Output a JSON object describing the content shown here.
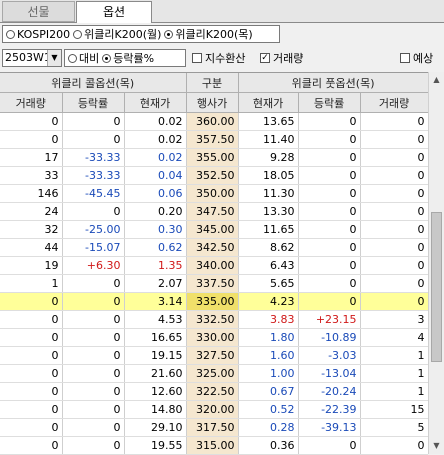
{
  "tabs": [
    "선물",
    "옵션"
  ],
  "radios": [
    "KOSPI200",
    "위클리K200(월)",
    "위클리K200(목)"
  ],
  "month_combo": "2503W1",
  "radio2": [
    "대비",
    "등락률%"
  ],
  "checks": {
    "index_conv": "지수환산",
    "volume": "거래량",
    "expected": "예상"
  },
  "header": {
    "call_group": "위클리 콜옵션(목)",
    "category": "구분",
    "put_group": "위클리 풋옵션(목)",
    "call_cols": [
      "거래량",
      "등락률",
      "현재가"
    ],
    "strike_col": "행사가",
    "put_cols": [
      "현재가",
      "등락률",
      "거래량"
    ]
  },
  "rows": [
    {
      "cv": "0",
      "cr": "0",
      "cp": "0.02",
      "k": "360.00",
      "pp": "13.65",
      "pr": "0",
      "pv": "0"
    },
    {
      "cv": "0",
      "cr": "0",
      "cp": "0.02",
      "k": "357.50",
      "pp": "11.40",
      "pr": "0",
      "pv": "0"
    },
    {
      "cv": "17",
      "cr": "-33.33",
      "cp": "0.02",
      "k": "355.00",
      "pp": "9.28",
      "pr": "0",
      "pv": "0"
    },
    {
      "cv": "33",
      "cr": "-33.33",
      "cp": "0.04",
      "k": "352.50",
      "pp": "18.05",
      "pr": "0",
      "pv": "0"
    },
    {
      "cv": "146",
      "cr": "-45.45",
      "cp": "0.06",
      "k": "350.00",
      "pp": "11.30",
      "pr": "0",
      "pv": "0"
    },
    {
      "cv": "24",
      "cr": "0",
      "cp": "0.20",
      "k": "347.50",
      "pp": "13.30",
      "pr": "0",
      "pv": "0"
    },
    {
      "cv": "32",
      "cr": "-25.00",
      "cp": "0.30",
      "k": "345.00",
      "pp": "11.65",
      "pr": "0",
      "pv": "0"
    },
    {
      "cv": "44",
      "cr": "-15.07",
      "cp": "0.62",
      "k": "342.50",
      "pp": "8.62",
      "pr": "0",
      "pv": "0"
    },
    {
      "cv": "19",
      "cr": "+6.30",
      "cp": "1.35",
      "k": "340.00",
      "pp": "6.43",
      "pr": "0",
      "pv": "0"
    },
    {
      "cv": "1",
      "cr": "0",
      "cp": "2.07",
      "k": "337.50",
      "pp": "5.65",
      "pr": "0",
      "pv": "0"
    },
    {
      "cv": "0",
      "cr": "0",
      "cp": "3.14",
      "k": "335.00",
      "pp": "4.23",
      "pr": "0",
      "pv": "0"
    },
    {
      "cv": "0",
      "cr": "0",
      "cp": "4.53",
      "k": "332.50",
      "pp": "3.83",
      "pr": "+23.15",
      "pv": "3"
    },
    {
      "cv": "0",
      "cr": "0",
      "cp": "16.65",
      "k": "330.00",
      "pp": "1.80",
      "pr": "-10.89",
      "pv": "4"
    },
    {
      "cv": "0",
      "cr": "0",
      "cp": "19.15",
      "k": "327.50",
      "pp": "1.60",
      "pr": "-3.03",
      "pv": "1"
    },
    {
      "cv": "0",
      "cr": "0",
      "cp": "21.60",
      "k": "325.00",
      "pp": "1.00",
      "pr": "-13.04",
      "pv": "1"
    },
    {
      "cv": "0",
      "cr": "0",
      "cp": "12.60",
      "k": "322.50",
      "pp": "0.67",
      "pr": "-20.24",
      "pv": "1"
    },
    {
      "cv": "0",
      "cr": "0",
      "cp": "14.80",
      "k": "320.00",
      "pp": "0.52",
      "pr": "-22.39",
      "pv": "15"
    },
    {
      "cv": "0",
      "cr": "0",
      "cp": "29.10",
      "k": "317.50",
      "pp": "0.28",
      "pr": "-39.13",
      "pv": "5"
    },
    {
      "cv": "0",
      "cr": "0",
      "cp": "19.55",
      "k": "315.00",
      "pp": "0.36",
      "pr": "0",
      "pv": "0"
    }
  ],
  "atm_strike": "335.00",
  "colors": {
    "up": "#d01818",
    "down": "#1a4ab8",
    "atm_row": "#ffff99",
    "strike_col": "#f5e7cf"
  }
}
